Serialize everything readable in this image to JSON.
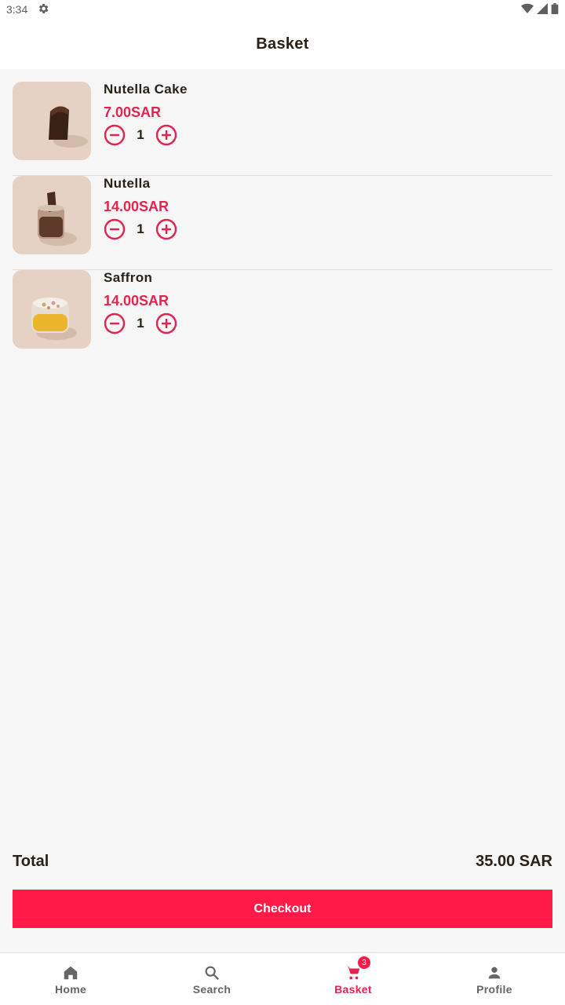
{
  "status_bar": {
    "time": "3:34"
  },
  "app_bar": {
    "title": "Basket"
  },
  "items": [
    {
      "name": "Nutella Cake",
      "price": "7.00SAR",
      "quantity": "1"
    },
    {
      "name": "Nutella",
      "price": "14.00SAR",
      "quantity": "1"
    },
    {
      "name": "Saffron",
      "price": "14.00SAR",
      "quantity": "1"
    }
  ],
  "summary": {
    "total_label": "Total",
    "total_value": "35.00 SAR"
  },
  "checkout_label": "Checkout",
  "bottom_nav": {
    "items": [
      {
        "label": "Home",
        "icon": "home-icon"
      },
      {
        "label": "Search",
        "icon": "search-icon"
      },
      {
        "label": "Basket",
        "icon": "cart-icon",
        "badge": "3",
        "active": true
      },
      {
        "label": "Profile",
        "icon": "person-icon"
      }
    ]
  },
  "colors": {
    "accent": "#ff1a47",
    "price": "#e4234e",
    "background": "#f6f6f6"
  }
}
